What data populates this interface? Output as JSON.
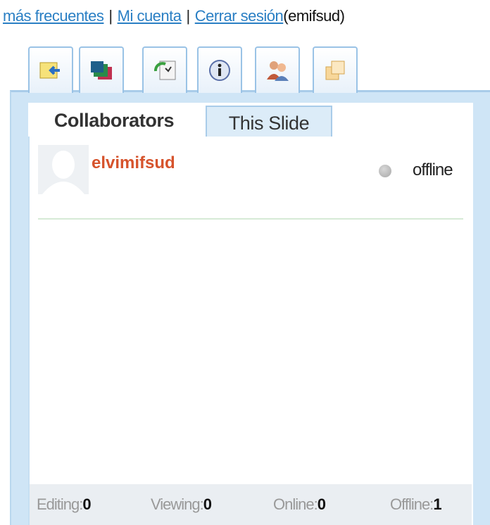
{
  "topbar": {
    "link_frequent": "más frecuentes",
    "link_account": "Mi cuenta",
    "link_logout": "Cerrar sesión",
    "username": "(emifsud)",
    "separator": "|"
  },
  "icon_tabs": [
    {
      "icon": "import-icon"
    },
    {
      "icon": "slides-icon"
    },
    {
      "icon": "history-icon"
    },
    {
      "icon": "info-icon"
    },
    {
      "icon": "users-icon"
    },
    {
      "icon": "layers-icon"
    }
  ],
  "subtabs": {
    "collaborators": "Collaborators",
    "this_slide": "This Slide"
  },
  "collaborator": {
    "name": "elvimifsud",
    "status": "offline"
  },
  "footer": {
    "editing_label": "Editing:",
    "editing_count": "0",
    "viewing_label": "Viewing:",
    "viewing_count": "0",
    "online_label": "Online:",
    "online_count": "0",
    "offline_label": "Offline:",
    "offline_count": "1"
  },
  "colors": {
    "link": "#2a7fc4",
    "username": "#d6532c",
    "panel": "#cfe5f6"
  }
}
